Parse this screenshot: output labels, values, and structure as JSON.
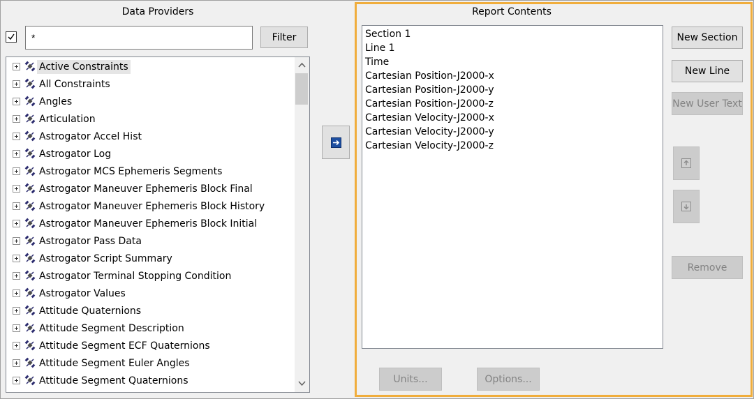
{
  "data_providers": {
    "title": "Data Providers",
    "filter_checked": true,
    "filter_value": "*",
    "filter_button": "Filter",
    "items": [
      {
        "label": "Active Constraints",
        "icon": "satellite-icon"
      },
      {
        "label": "All Constraints",
        "icon": "satellite-icon"
      },
      {
        "label": "Angles",
        "icon": "satellite-icon"
      },
      {
        "label": "Articulation",
        "icon": "satellite-icon"
      },
      {
        "label": "Astrogator Accel Hist",
        "icon": "satellite-icon"
      },
      {
        "label": "Astrogator Log",
        "icon": "satellite-icon"
      },
      {
        "label": "Astrogator MCS Ephemeris Segments",
        "icon": "satellite-icon"
      },
      {
        "label": "Astrogator Maneuver Ephemeris Block Final",
        "icon": "satellite-icon"
      },
      {
        "label": "Astrogator Maneuver Ephemeris Block History",
        "icon": "satellite-icon"
      },
      {
        "label": "Astrogator Maneuver Ephemeris Block Initial",
        "icon": "satellite-icon"
      },
      {
        "label": "Astrogator Pass Data",
        "icon": "satellite-icon"
      },
      {
        "label": "Astrogator Script Summary",
        "icon": "satellite-icon"
      },
      {
        "label": "Astrogator Terminal Stopping Condition",
        "icon": "satellite-icon"
      },
      {
        "label": "Astrogator Values",
        "icon": "satellite-icon"
      },
      {
        "label": "Attitude Quaternions",
        "icon": "satellite-icon"
      },
      {
        "label": "Attitude Segment Description",
        "icon": "satellite-icon"
      },
      {
        "label": "Attitude Segment ECF Quaternions",
        "icon": "satellite-icon"
      },
      {
        "label": "Attitude Segment Euler Angles",
        "icon": "satellite-icon"
      },
      {
        "label": "Attitude Segment Quaternions",
        "icon": "satellite-icon"
      }
    ],
    "selected_item": "Active Constraints"
  },
  "add_button": {
    "icon": "arrow-right-icon"
  },
  "report_contents": {
    "title": "Report Contents",
    "items": [
      "Section 1",
      "Line 1",
      "Time",
      "Cartesian Position-J2000-x",
      "Cartesian Position-J2000-y",
      "Cartesian Position-J2000-z",
      "Cartesian Velocity-J2000-x",
      "Cartesian Velocity-J2000-y",
      "Cartesian Velocity-J2000-z"
    ],
    "buttons": {
      "new_section": "New Section",
      "new_line": "New Line",
      "new_user_text": "New User Text",
      "remove": "Remove",
      "units": "Units...",
      "options": "Options..."
    },
    "move_up_icon": "move-up-icon",
    "move_down_icon": "move-down-icon",
    "highlight_color": "#f0ad3c"
  },
  "colors": {
    "background": "#f0f0f0",
    "button": "#e1e1e1",
    "button_disabled": "#cccccc",
    "arrow_blue": "#1e4fa0"
  }
}
